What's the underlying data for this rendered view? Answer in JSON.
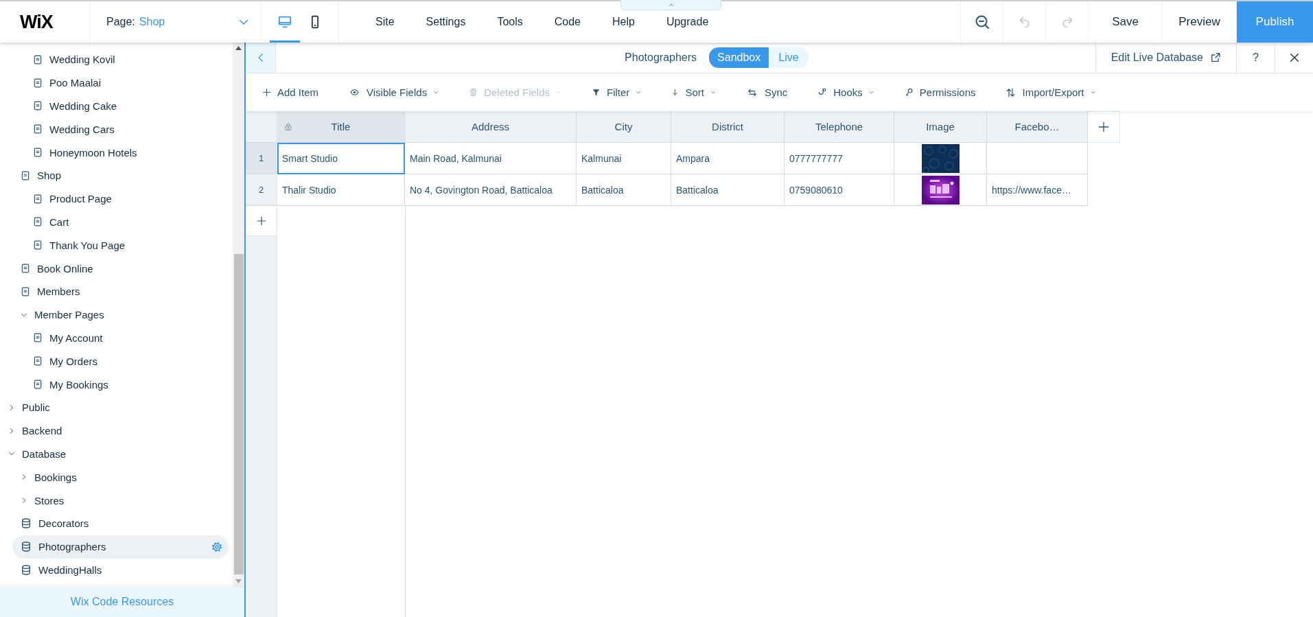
{
  "top_bar": {
    "logo": "WiX",
    "page_selector": {
      "label": "Page:",
      "value": "Shop"
    },
    "view_modes": [
      {
        "kind": "desktop",
        "selected": true
      },
      {
        "kind": "mobile",
        "selected": false
      }
    ],
    "menu": [
      "Site",
      "Settings",
      "Tools",
      "Code",
      "Help",
      "Upgrade"
    ],
    "actions": [
      {
        "kind": "zoom",
        "disabled": false
      },
      {
        "kind": "undo",
        "disabled": true
      },
      {
        "kind": "redo",
        "disabled": true
      }
    ],
    "buttons": [
      {
        "label": "Save",
        "primary": false
      },
      {
        "label": "Preview",
        "primary": false
      },
      {
        "label": "Publish",
        "primary": true
      }
    ]
  },
  "sidebar": {
    "tree": [
      {
        "children": [
          {
            "children": [
              {
                "kind": "page",
                "label": "Wedding Kovil",
                "selected": false
              },
              {
                "kind": "page",
                "label": "Poo Maalai",
                "selected": false
              },
              {
                "kind": "page",
                "label": "Wedding Cake",
                "selected": false
              },
              {
                "kind": "page",
                "label": "Wedding Cars",
                "selected": false
              },
              {
                "kind": "page",
                "label": "Honeymoon Hotels",
                "selected": false
              }
            ]
          },
          {
            "kind": "page",
            "label": "Shop",
            "selected": false,
            "children": [
              {
                "kind": "page",
                "label": "Product Page",
                "selected": false
              },
              {
                "kind": "page",
                "label": "Cart",
                "selected": false
              },
              {
                "kind": "page",
                "label": "Thank You Page",
                "selected": false
              }
            ]
          },
          {
            "kind": "page",
            "label": "Book Online",
            "selected": false
          },
          {
            "kind": "page",
            "label": "Members",
            "selected": false
          },
          {
            "kind": "folder",
            "label": "Member Pages",
            "expanded": true,
            "selected": false,
            "children": [
              {
                "kind": "page",
                "label": "My Account",
                "selected": false
              },
              {
                "kind": "page",
                "label": "My Orders",
                "selected": false
              },
              {
                "kind": "page",
                "label": "My Bookings",
                "selected": false
              }
            ]
          }
        ]
      },
      {
        "kind": "folder",
        "label": "Public",
        "expanded": false,
        "selected": false
      },
      {
        "kind": "folder",
        "label": "Backend",
        "expanded": false,
        "selected": false
      },
      {
        "kind": "folder",
        "label": "Database",
        "expanded": true,
        "selected": false,
        "children": [
          {
            "kind": "folder",
            "label": "Bookings",
            "expanded": false,
            "selected": false
          },
          {
            "kind": "folder",
            "label": "Stores",
            "expanded": false,
            "selected": false
          },
          {
            "kind": "collection",
            "label": "Decorators",
            "selected": false
          },
          {
            "kind": "collection",
            "label": "Photographers",
            "selected": true
          },
          {
            "kind": "collection",
            "label": "WeddingHalls",
            "selected": false
          }
        ]
      }
    ],
    "footer_link": "Wix Code Resources"
  },
  "collection": {
    "title": "Photographers",
    "modes": [
      {
        "label": "Sandbox",
        "selected": true
      },
      {
        "label": "Live",
        "selected": false
      }
    ],
    "edit_live": "Edit Live Database",
    "help": "?",
    "toolbar": [
      {
        "kind": "add",
        "label": "Add Item",
        "dropdown": false,
        "disabled": false
      },
      {
        "kind": "visible",
        "label": "Visible Fields",
        "dropdown": true,
        "disabled": false
      },
      {
        "kind": "deleted",
        "label": "Deleted Fields",
        "dropdown": true,
        "disabled": true
      },
      {
        "kind": "filter",
        "label": "Filter",
        "dropdown": true,
        "disabled": false
      },
      {
        "kind": "sort",
        "label": "Sort",
        "dropdown": true,
        "disabled": false
      },
      {
        "kind": "sync",
        "label": "Sync",
        "dropdown": false,
        "disabled": false
      },
      {
        "kind": "hooks",
        "label": "Hooks",
        "dropdown": true,
        "disabled": false
      },
      {
        "kind": "permissions",
        "label": "Permissions",
        "dropdown": false,
        "disabled": false
      },
      {
        "kind": "import_export",
        "label": "Import/Export",
        "dropdown": true,
        "disabled": false
      }
    ],
    "table": {
      "columns": [
        {
          "label": "Title",
          "locked": true
        },
        {
          "label": "Address",
          "locked": false
        },
        {
          "label": "City",
          "locked": false
        },
        {
          "label": "District",
          "locked": false
        },
        {
          "label": "Telephone",
          "locked": false
        },
        {
          "label": "Image",
          "locked": false
        },
        {
          "label": "Facebo…",
          "locked": false
        }
      ],
      "rows": [
        {
          "number": "1",
          "cells": [
            {
              "kind": "text",
              "text": "Smart Studio",
              "selected": true
            },
            {
              "kind": "text",
              "text": "Main Road, Kalmunai",
              "selected": false
            },
            {
              "kind": "text",
              "text": "Kalmunai",
              "selected": false
            },
            {
              "kind": "text",
              "text": "Ampara",
              "selected": false
            },
            {
              "kind": "text",
              "text": "0777777777",
              "selected": false
            },
            {
              "kind": "picture",
              "selected": false
            },
            {
              "kind": "text",
              "selected": false
            }
          ]
        },
        {
          "number": "2",
          "cells": [
            {
              "kind": "text",
              "text": "Thalir Studio",
              "selected": false
            },
            {
              "kind": "text",
              "text": "No 4, Govington Road, Batticaloa",
              "selected": false
            },
            {
              "kind": "text",
              "text": "Batticaloa",
              "selected": false
            },
            {
              "kind": "text",
              "text": "Batticaloa",
              "selected": false
            },
            {
              "kind": "text",
              "text": "0759080610",
              "selected": false
            },
            {
              "kind": "picture",
              "selected": false
            },
            {
              "kind": "text",
              "text": "https://www.face…",
              "selected": false
            }
          ]
        }
      ]
    }
  }
}
